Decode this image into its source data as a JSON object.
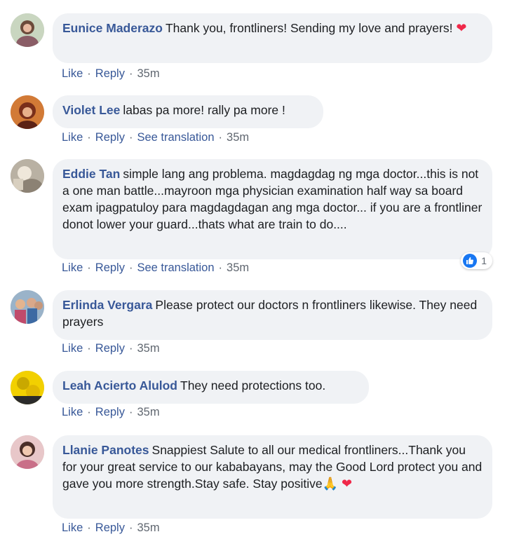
{
  "actions": {
    "like": "Like",
    "reply": "Reply",
    "see_translation": "See translation",
    "dot": "·"
  },
  "comments": [
    {
      "author": "Eunice Maderazo",
      "text": "Thank you, frontliners! Sending my love and prayers!",
      "emoji": "❤",
      "time": "35m"
    },
    {
      "author": "Violet Lee",
      "text": "labas pa more! rally pa more !",
      "time": "35m"
    },
    {
      "author": "Eddie Tan",
      "text": "simple lang ang problema. magdagdag ng mga doctor...this is not a one man battle...mayroon mga physician examination half way sa board exam ipagpatuloy para magdagdagan ang mga doctor... if you are a frontliner donot lower your guard...thats what are train to do....",
      "time": "35m",
      "reaction_count": "1"
    },
    {
      "author": "Erlinda Vergara",
      "text": "Please protect our doctors n frontliners likewise. They need prayers",
      "time": "35m"
    },
    {
      "author": "Leah Acierto Alulod",
      "text": "They need protections too.",
      "time": "35m"
    },
    {
      "author": "Llanie Panotes",
      "text": "Snappiest Salute to all our medical frontliners...Thank you for your great service to our kababayans, may the Good Lord protect you and gave you more strength.Stay safe. Stay positive",
      "emoji": "🙏 ❤",
      "time": "35m"
    }
  ]
}
